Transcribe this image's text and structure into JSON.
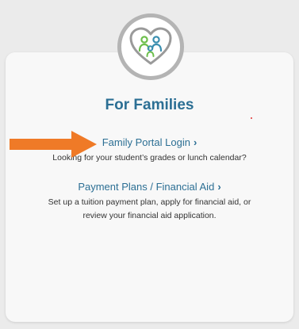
{
  "section": {
    "title": "For Families"
  },
  "links": [
    {
      "label": "Family Portal Login",
      "chevron": "›",
      "description": "Looking for your student’s grades or lunch calendar?"
    },
    {
      "label": "Payment Plans / Financial Aid",
      "chevron": "›",
      "description_line1": "Set up a tuition payment plan, apply for financial aid, or",
      "description_line2": "review your financial aid application."
    }
  ],
  "colors": {
    "accent": "#2c6f94",
    "icon_green": "#6cbf4b",
    "icon_teal": "#3a8fb0",
    "arrow_orange": "#ef7a27",
    "circle_border": "#b4b4b4"
  },
  "icons": {
    "badge": "family-heart-icon",
    "pointer": "orange-arrow-icon"
  }
}
